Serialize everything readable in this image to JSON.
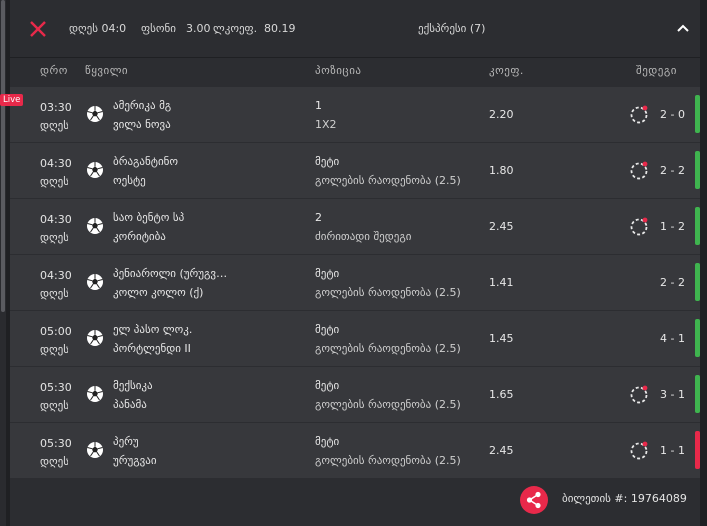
{
  "header": {
    "stake_label": "დღეს 04:0",
    "price_label": "ფსონი",
    "price_value": "3.00",
    "coef_label": "ლკოეფ.",
    "coef_value": "80.19",
    "express_label": "ექსპრესი (7)"
  },
  "columns": {
    "time": "დრო",
    "event": "წყვილი",
    "position": "პოზიცია",
    "coef": "კოეფ.",
    "result": "შედეგი"
  },
  "rows": [
    {
      "live": "Live",
      "time": "03:30",
      "day": "დღეს",
      "team1": "ამერიკა მგ",
      "team2": "ვილა ნოვა",
      "pos1": "1",
      "pos2": "1X2",
      "odd": "2.20",
      "score": "2 - 0",
      "status_color": "#3fb44f",
      "spinner": true
    },
    {
      "live": "",
      "time": "04:30",
      "day": "დღეს",
      "team1": "ბრაგანტინო",
      "team2": "ოესტე",
      "pos1": "მეტი",
      "pos2": "გოლების რაოდენობა (2.5)",
      "odd": "1.80",
      "score": "2 - 2",
      "status_color": "#3fb44f",
      "spinner": true
    },
    {
      "live": "",
      "time": "04:30",
      "day": "დღეს",
      "team1": "საო ბენტო სპ",
      "team2": "კორიტიბა",
      "pos1": "2",
      "pos2": "ძირითადი შედეგი",
      "odd": "2.45",
      "score": "1 - 2",
      "status_color": "#3fb44f",
      "spinner": true
    },
    {
      "live": "",
      "time": "04:30",
      "day": "დღეს",
      "team1": "პენიაროლი (ურუგვაი)",
      "team2": "კოლო კოლო (ქ)",
      "pos1": "მეტი",
      "pos2": "გოლების რაოდენობა (2.5)",
      "odd": "1.41",
      "score": "2 - 2",
      "status_color": "#3fb44f",
      "spinner": false
    },
    {
      "live": "",
      "time": "05:00",
      "day": "დღეს",
      "team1": "ელ პასო ლოკ.",
      "team2": "პორტლენდი II",
      "pos1": "მეტი",
      "pos2": "გოლების რაოდენობა (2.5)",
      "odd": "1.45",
      "score": "4 - 1",
      "status_color": "#3fb44f",
      "spinner": false
    },
    {
      "live": "",
      "time": "05:30",
      "day": "დღეს",
      "team1": "მექსიკა",
      "team2": "პანამა",
      "pos1": "მეტი",
      "pos2": "გოლების რაოდენობა (2.5)",
      "odd": "1.65",
      "score": "3 - 1",
      "status_color": "#3fb44f",
      "spinner": true
    },
    {
      "live": "",
      "time": "05:30",
      "day": "დღეს",
      "team1": "პერუ",
      "team2": "ურუგვაი",
      "pos1": "მეტი",
      "pos2": "გოლების რაოდენობა (2.5)",
      "odd": "2.45",
      "score": "1 - 1",
      "status_color": "#e8294a",
      "spinner": true
    }
  ],
  "footer": {
    "ticket_label": "ბილეთის #:",
    "ticket_number": "19764089"
  },
  "colors": {
    "accent": "#e8294a",
    "win": "#3fb44f",
    "lose": "#e8294a"
  }
}
